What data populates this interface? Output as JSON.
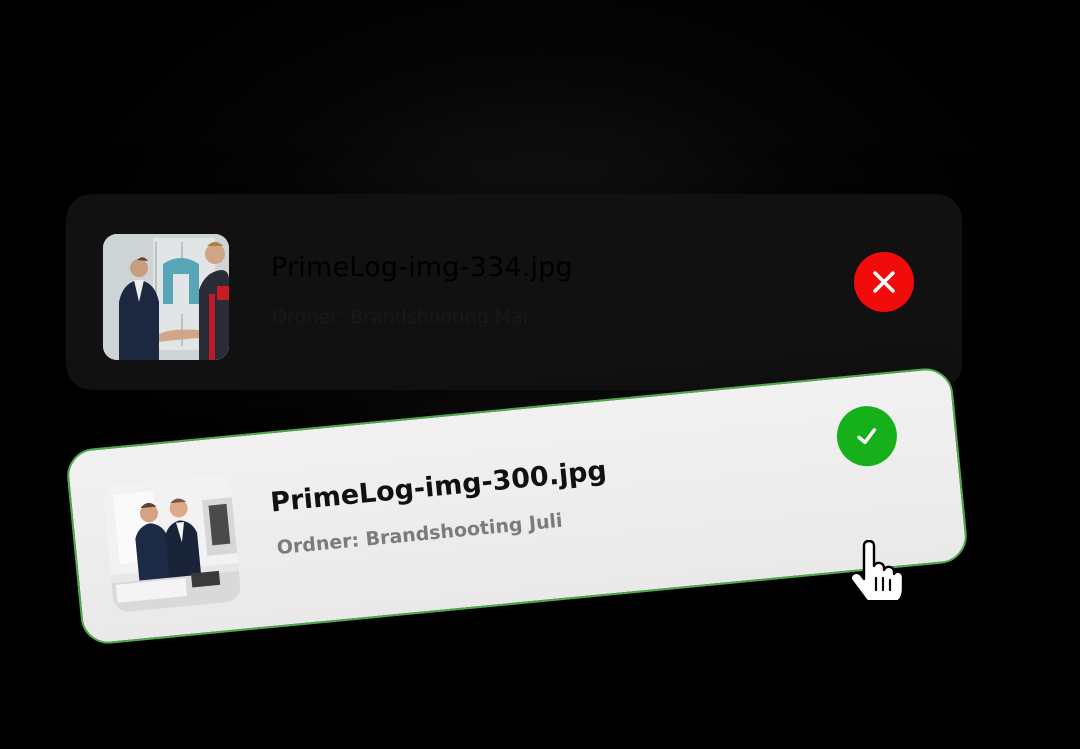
{
  "cards": [
    {
      "state": "rejected",
      "filename": "PrimeLog-img-334.jpg",
      "folder": "Ordner: Brandshooting Mai",
      "status_icon": "close-icon",
      "status_color": "#f10b0b"
    },
    {
      "state": "accepted",
      "filename": "PrimeLog-img-300.jpg",
      "folder": "Ordner: Brandshooting Juli",
      "status_icon": "check-icon",
      "status_color": "#16b01a",
      "border_color": "#4ea94b"
    }
  ],
  "cursor_icon": "hand-pointer-icon"
}
